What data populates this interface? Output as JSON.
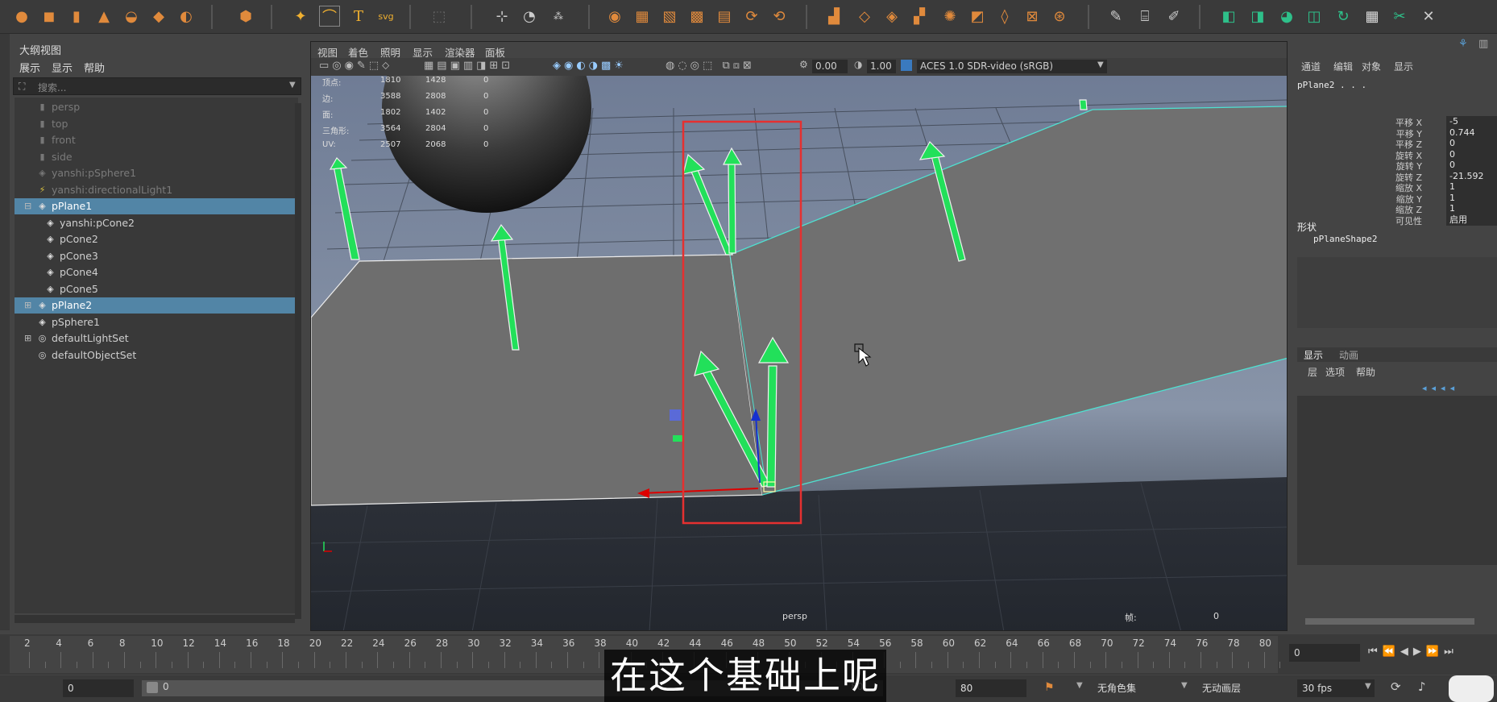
{
  "outliner": {
    "title": "大纲视图",
    "menu": [
      "展示",
      "显示",
      "帮助"
    ],
    "search_placeholder": "搜索...",
    "items": [
      {
        "label": "persp",
        "dim": true,
        "icon": "camera-icon",
        "indent": 0
      },
      {
        "label": "top",
        "dim": true,
        "icon": "camera-icon",
        "indent": 0
      },
      {
        "label": "front",
        "dim": true,
        "icon": "camera-icon",
        "indent": 0
      },
      {
        "label": "side",
        "dim": true,
        "icon": "camera-icon",
        "indent": 0
      },
      {
        "label": "yanshi:pSphere1",
        "dim": true,
        "icon": "mesh-icon",
        "indent": 0
      },
      {
        "label": "yanshi:directionalLight1",
        "dim": true,
        "icon": "light-icon",
        "indent": 0
      },
      {
        "label": "pPlane1",
        "selected": true,
        "icon": "mesh-icon",
        "indent": 0,
        "expand": "⊟"
      },
      {
        "label": "yanshi:pCone2",
        "icon": "mesh-icon",
        "indent": 1
      },
      {
        "label": "pCone2",
        "icon": "mesh-icon",
        "indent": 1
      },
      {
        "label": "pCone3",
        "icon": "mesh-icon",
        "indent": 1
      },
      {
        "label": "pCone4",
        "icon": "mesh-icon",
        "indent": 1
      },
      {
        "label": "pCone5",
        "icon": "mesh-icon",
        "indent": 1
      },
      {
        "label": "pPlane2",
        "selected": true,
        "icon": "mesh-icon",
        "indent": 0,
        "expand": "⊞"
      },
      {
        "label": "pSphere1",
        "icon": "mesh-icon",
        "indent": 0
      },
      {
        "label": "defaultLightSet",
        "icon": "set-icon",
        "indent": 0,
        "expand": "⊞"
      },
      {
        "label": "defaultObjectSet",
        "icon": "set-icon",
        "indent": 0
      }
    ]
  },
  "viewport": {
    "menu": [
      "视图",
      "着色",
      "照明",
      "显示",
      "渲染器",
      "面板"
    ],
    "field_a": "0.00",
    "field_b": "1.00",
    "colorspace": "ACES 1.0 SDR-video (sRGB)",
    "camera_label": "persp",
    "hud_right_label": "帧:",
    "hud_right_value": "0",
    "stats": [
      {
        "label": "顶点:",
        "a": "1810",
        "b": "1428",
        "c": "0"
      },
      {
        "label": "边:",
        "a": "3588",
        "b": "2808",
        "c": "0"
      },
      {
        "label": "面:",
        "a": "1802",
        "b": "1402",
        "c": "0"
      },
      {
        "label": "三角形:",
        "a": "3564",
        "b": "2804",
        "c": "0"
      },
      {
        "label": "UV:",
        "a": "2507",
        "b": "2068",
        "c": "0"
      }
    ]
  },
  "channelbox": {
    "menu": [
      "通道",
      "编辑",
      "对象",
      "显示"
    ],
    "object_name": "pPlane2 . . .",
    "channels": [
      {
        "label": "平移 X",
        "value": "-5"
      },
      {
        "label": "平移 Y",
        "value": "0.744"
      },
      {
        "label": "平移 Z",
        "value": "0"
      },
      {
        "label": "旋转 X",
        "value": "0"
      },
      {
        "label": "旋转 Y",
        "value": "0"
      },
      {
        "label": "旋转 Z",
        "value": "-21.592"
      },
      {
        "label": "缩放 X",
        "value": "1"
      },
      {
        "label": "缩放 Y",
        "value": "1"
      },
      {
        "label": "缩放 Z",
        "value": "1"
      },
      {
        "label": "可见性",
        "value": "启用"
      }
    ],
    "shapes_title": "形状",
    "shape_name": "pPlaneShape2",
    "layer_tabs": [
      "显示",
      "动画"
    ],
    "layer_menu": [
      "层",
      "选项",
      "帮助"
    ]
  },
  "timeline": {
    "ticks": [
      "2",
      "4",
      "6",
      "8",
      "10",
      "12",
      "14",
      "16",
      "18",
      "20",
      "22",
      "24",
      "26",
      "28",
      "30",
      "32",
      "34",
      "36",
      "38",
      "40",
      "42",
      "44",
      "46",
      "48",
      "50",
      "52",
      "54",
      "56",
      "58",
      "60",
      "62",
      "64",
      "66",
      "68",
      "70",
      "72",
      "74",
      "76",
      "78",
      "80"
    ],
    "current_frame": "0"
  },
  "rangebar": {
    "start": "0",
    "range_start": "0",
    "range_end": "80",
    "end": "80",
    "char_set": "无角色集",
    "anim_layer": "无动画层",
    "fps": "30 fps"
  },
  "subtitle": "在这个基础上呢",
  "colors": {
    "selection": "#5285a6",
    "arrow_green": "#22e05a",
    "highlight_red": "#e53030",
    "edge_cyan": "#4fe0d0"
  }
}
